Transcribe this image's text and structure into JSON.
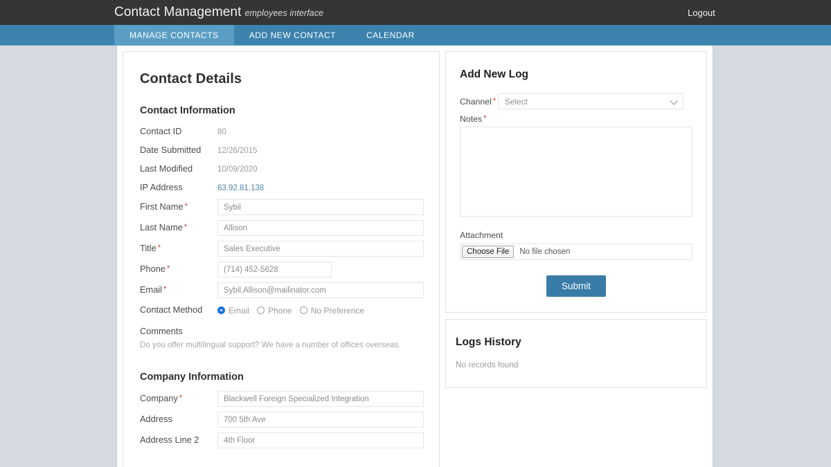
{
  "topbar": {
    "brand": "Contact Management",
    "brand_sub": "employees interface",
    "logout": "Logout"
  },
  "nav": {
    "tabs": [
      {
        "label": "MANAGE CONTACTS",
        "active": true
      },
      {
        "label": "ADD NEW CONTACT",
        "active": false
      },
      {
        "label": "CALENDAR",
        "active": false
      }
    ]
  },
  "contact_details": {
    "title": "Contact Details",
    "contact_information_heading": "Contact Information",
    "static_fields": [
      {
        "label": "Contact ID",
        "value": "80"
      },
      {
        "label": "Date Submitted",
        "value": "12/26/2015"
      },
      {
        "label": "Last Modified",
        "value": "10/09/2020"
      },
      {
        "label": "IP Address",
        "value": "63.92.81.138"
      }
    ],
    "fields": [
      {
        "label": "First Name",
        "value": "Sybil"
      },
      {
        "label": "Last Name",
        "value": "Allison"
      },
      {
        "label": "Title",
        "value": "Sales Executive"
      },
      {
        "label": "Phone",
        "value": "(714) 452-5628"
      },
      {
        "label": "Email",
        "value": "Sybil.Allison@mailinator.com"
      }
    ],
    "contact_method": {
      "label": "Contact Method",
      "options": [
        {
          "label": "Email",
          "selected": true
        },
        {
          "label": "Phone",
          "selected": false
        },
        {
          "label": "No Preference",
          "selected": false
        }
      ]
    },
    "comments": {
      "label": "Comments",
      "text": "Do you offer multilingual support? We have a number of offices overseas."
    },
    "company_information_heading": "Company Information",
    "company_fields": [
      {
        "label": "Company",
        "value": "Blackwell Foreign Specialized Integration"
      },
      {
        "label": "Address",
        "value": "700 5th Ave"
      },
      {
        "label": "Address Line 2",
        "value": "4th Floor"
      }
    ]
  },
  "add_new_log": {
    "title": "Add New Log",
    "channel_label": "Channel",
    "channel_value": "Select",
    "notes_label": "Notes",
    "notes_value": "",
    "attachment_label": "Attachment",
    "choose_file_label": "Choose File",
    "file_status": "No file chosen",
    "submit_label": "Submit"
  },
  "logs_history": {
    "title": "Logs History",
    "empty_message": "No records found"
  },
  "colors": {
    "topbar": "#333537",
    "nav": "#3b82ad",
    "nav_active": "#5b9ec4",
    "submit": "#3a7ca8",
    "link": "#4f86a8",
    "required": "#c9302c",
    "radio_selected": "#1a73e8",
    "page_background": "#d5d9e0"
  }
}
